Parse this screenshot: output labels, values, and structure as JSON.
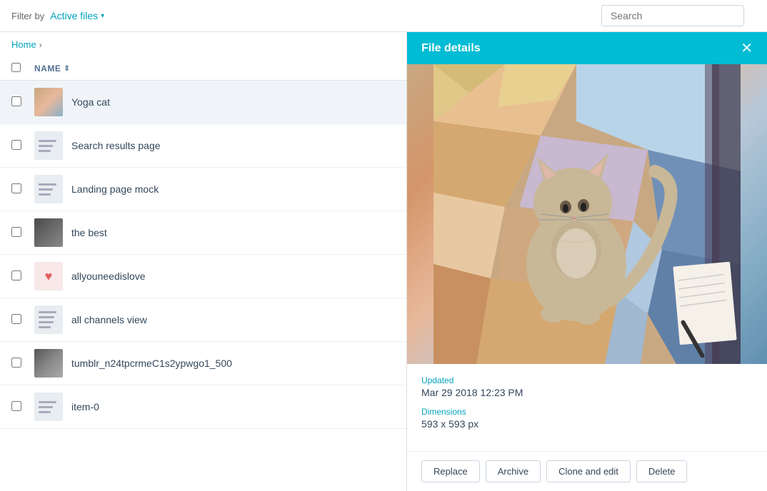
{
  "topBar": {
    "filterLabel": "Filter by",
    "activeFilter": "Active files",
    "searchPlaceholder": "Search"
  },
  "breadcrumb": {
    "home": "Home",
    "separator": "›"
  },
  "table": {
    "nameHeader": "NAME",
    "rows": [
      {
        "id": 1,
        "name": "Yoga cat",
        "thumbType": "image",
        "selected": true
      },
      {
        "id": 2,
        "name": "Search results page",
        "thumbType": "lines"
      },
      {
        "id": 3,
        "name": "Landing page mock",
        "thumbType": "lines"
      },
      {
        "id": 4,
        "name": "the best",
        "thumbType": "dark"
      },
      {
        "id": 5,
        "name": "allyouneedislove",
        "thumbType": "heart"
      },
      {
        "id": 6,
        "name": "all channels view",
        "thumbType": "lines2"
      },
      {
        "id": 7,
        "name": "tumblr_n24tpcrmeC1s2ypwgo1_500",
        "thumbType": "dark2"
      },
      {
        "id": 8,
        "name": "item-0",
        "thumbType": "lines"
      }
    ]
  },
  "fileDetails": {
    "panelTitle": "File details",
    "updatedLabel": "Updated",
    "updatedValue": "Mar 29 2018 12:23 PM",
    "dimensionsLabel": "Dimensions",
    "dimensionsValue": "593 x 593 px"
  },
  "actions": {
    "replace": "Replace",
    "archive": "Archive",
    "cloneAndEdit": "Clone and edit",
    "delete": "Delete"
  }
}
